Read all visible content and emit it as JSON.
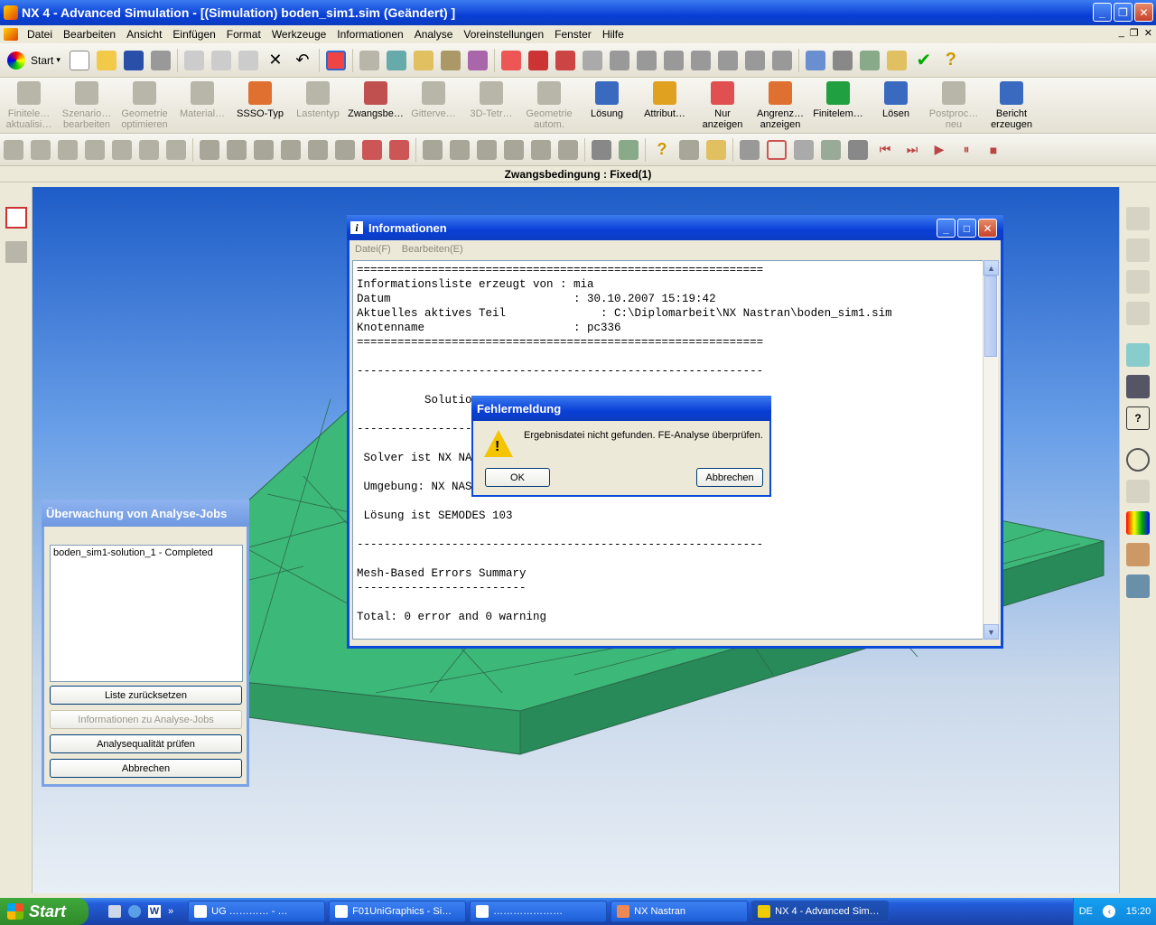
{
  "window": {
    "title": "NX 4 - Advanced Simulation - [(Simulation) boden_sim1.sim (Geändert) ]"
  },
  "menu": [
    "Datei",
    "Bearbeiten",
    "Ansicht",
    "Einfügen",
    "Format",
    "Werkzeuge",
    "Informationen",
    "Analyse",
    "Voreinstellungen",
    "Fenster",
    "Hilfe"
  ],
  "toolbar1": {
    "start_label": "Start"
  },
  "toolbar2": [
    {
      "label": "Finitele…\naktualisi…",
      "disabled": true
    },
    {
      "label": "Szenario…\nbearbeiten",
      "disabled": true
    },
    {
      "label": "Geometrie\noptimieren",
      "disabled": true
    },
    {
      "label": "Material…",
      "disabled": true
    },
    {
      "label": "SSSO-Typ",
      "disabled": false
    },
    {
      "label": "Lastentyp",
      "disabled": true
    },
    {
      "label": "Zwangsbe…",
      "disabled": false
    },
    {
      "label": "Gitterve…",
      "disabled": true
    },
    {
      "label": "3D-Tetr…",
      "disabled": true
    },
    {
      "label": "Geometrie\nautom.",
      "disabled": true
    },
    {
      "label": "Lösung",
      "disabled": false
    },
    {
      "label": "Attribut…",
      "disabled": false
    },
    {
      "label": "Nur\nanzeigen",
      "disabled": false
    },
    {
      "label": "Angrenz…\nanzeigen",
      "disabled": false
    },
    {
      "label": "Finitelem…",
      "disabled": false
    },
    {
      "label": "Lösen",
      "disabled": false
    },
    {
      "label": "Postproc…\nneu",
      "disabled": true
    },
    {
      "label": "Bericht\nerzeugen",
      "disabled": false
    }
  ],
  "status": "Zwangsbedingung : Fixed(1)",
  "info_window": {
    "title": "Informationen",
    "menu": [
      "Datei(F)",
      "Bearbeiten(E)"
    ],
    "text": "============================================================\nInformationsliste erzeugt von : mia\nDatum                           : 30.10.2007 15:19:42\nAktuelles aktives Teil              : C:\\Diplomarbeit\\NX Nastran\\boden_sim1.sim\nKnotenname                      : pc336\n============================================================\n\n------------------------------------------------------------\n\n          Solutio\n\n------------------------------------------------------------\n\n Solver ist NX NA\n\n Umgebung: NX NAS\n\n Lösung ist SEMODES 103\n\n------------------------------------------------------------\n\nMesh-Based Errors Summary\n-------------------------\n\nTotal: 0 error and 0 warning"
  },
  "error_dialog": {
    "title": "Fehlermeldung",
    "message": "Ergebnisdatei nicht gefunden. FE-Analyse überprüfen.",
    "ok_label": "OK",
    "cancel_label": "Abbrechen"
  },
  "job_monitor": {
    "title": "Überwachung von Analyse-Jobs",
    "items": [
      "boden_sim1-solution_1 - Completed"
    ],
    "btn_reset": "Liste zurücksetzen",
    "btn_info": "Informationen zu Analyse-Jobs",
    "btn_quality": "Analysequalität prüfen",
    "btn_cancel": "Abbrechen"
  },
  "taskbar": {
    "start": "Start",
    "tasks": [
      "UG ………… - …",
      "F01UniGraphics - Si…",
      "…………………",
      "NX Nastran",
      "NX 4 - Advanced Sim…"
    ],
    "lang": "DE",
    "time": "15:20"
  },
  "colors": {
    "mesh_green": "#3cb878",
    "xp_blue": "#0a3fd6"
  }
}
